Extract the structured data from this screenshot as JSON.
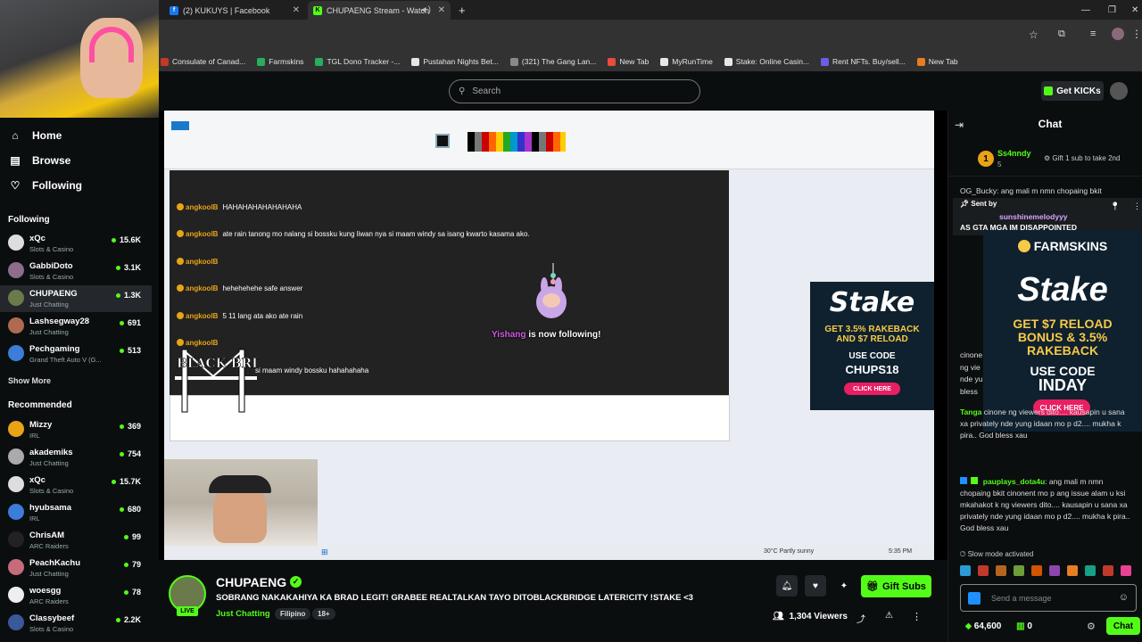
{
  "browser": {
    "tabs": [
      {
        "title": "(2) KUKUYS | Facebook",
        "active": false
      },
      {
        "title": "CHUPAENG Stream - Watch",
        "active": true
      }
    ],
    "new_tab_label": "+",
    "bookmarks": [
      {
        "label": "Consulate of Canad...",
        "color": "#c0392b"
      },
      {
        "label": "Farmskins",
        "color": "#27ae60"
      },
      {
        "label": "TGL Dono Tracker -...",
        "color": "#27ae60"
      },
      {
        "label": "Pustahan Nights Bet...",
        "color": "#e6e6e6"
      },
      {
        "label": "(321) The Gang Lan...",
        "color": "#888"
      },
      {
        "label": "New Tab",
        "color": "#e74c3c"
      },
      {
        "label": "MyRunTime",
        "color": "#e6e6e6"
      },
      {
        "label": "Stake: Online Casin...",
        "color": "#e6e6e6"
      },
      {
        "label": "Rent NFTs. Buy/sell...",
        "color": "#6c5ce7"
      },
      {
        "label": "New Tab",
        "color": "#e67e22"
      }
    ]
  },
  "topnav": {
    "search_placeholder": "Search",
    "get_kicks": "Get KICKs"
  },
  "sidebar": {
    "nav": [
      {
        "label": "Home",
        "icon": "home-icon"
      },
      {
        "label": "Browse",
        "icon": "browse-icon"
      },
      {
        "label": "Following",
        "icon": "heart-icon"
      }
    ],
    "following_title": "Following",
    "following": [
      {
        "name": "xQc",
        "category": "Slots & Casino",
        "viewers": "15.6K",
        "color": "#ddd"
      },
      {
        "name": "GabbiDoto",
        "category": "Slots & Casino",
        "viewers": "3.1K",
        "color": "#8e6c8a"
      },
      {
        "name": "CHUPAENG",
        "category": "Just Chatting",
        "viewers": "1.3K",
        "color": "#6a7a4a"
      },
      {
        "name": "Lashsegway28",
        "category": "Just Chatting",
        "viewers": "691",
        "color": "#b06a50"
      },
      {
        "name": "Pechgaming",
        "category": "Grand Theft Auto V (G...",
        "viewers": "513",
        "color": "#3b7dd8"
      }
    ],
    "show_more": "Show More",
    "recommended_title": "Recommended",
    "recommended": [
      {
        "name": "Mizzy",
        "category": "IRL",
        "viewers": "369",
        "color": "#e8a317"
      },
      {
        "name": "akademiks",
        "category": "Just Chatting",
        "viewers": "754",
        "color": "#aaa"
      },
      {
        "name": "xQc",
        "category": "Slots & Casino",
        "viewers": "15.7K",
        "color": "#ddd"
      },
      {
        "name": "hyubsama",
        "category": "IRL",
        "viewers": "680",
        "color": "#3b7dd8"
      },
      {
        "name": "ChrisAM",
        "category": "ARC Raiders",
        "viewers": "99",
        "color": "#222"
      },
      {
        "name": "PeachKachu",
        "category": "Just Chatting",
        "viewers": "79",
        "color": "#c56b7a"
      },
      {
        "name": "woesgg",
        "category": "ARC Raiders",
        "viewers": "78",
        "color": "#eee"
      },
      {
        "name": "Classybeef",
        "category": "Slots & Casino",
        "viewers": "2.2K",
        "color": "#3b5998"
      }
    ]
  },
  "stream_overlay": {
    "chat_lines": [
      {
        "user": "angkoolB",
        "text": "HAHAHAHAHAHAHAHA"
      },
      {
        "user": "angkoolB",
        "text": "ate rain tanong mo nalang si bossku kung liwan nya si maam windy sa isang kwarto kasama ako."
      },
      {
        "user": "angkoolB",
        "text": ""
      },
      {
        "user": "angkoolB",
        "text": "hehehehehe safe answer"
      },
      {
        "user": "angkoolB",
        "text": "5 11 lang ata ako ate rain"
      },
      {
        "user": "angkoolB",
        "text": ""
      },
      {
        "user": "",
        "text": "si maam windy bossku hahahahaha"
      }
    ],
    "follow_name": "Yishang",
    "follow_text": "is now following!",
    "watermark": "BLACK BRIDGE",
    "stake_ad": {
      "logo": "Stake",
      "headline": "GET 3.5% RAKEBACK AND $7 RELOAD",
      "use_code": "USE CODE",
      "code": "CHUPS18",
      "cta": "CLICK HERE"
    },
    "taskbar_weather": "30°C Partly sunny",
    "taskbar_time": "5:35 PM"
  },
  "stream_info": {
    "streamer": "CHUPAENG",
    "live_label": "LIVE",
    "title": "SOBRANG NAKAKAHIYA KA BRAD LEGIT! GRABEE REALTALKAN TAYO DITOBLACKBRIDGE LATER!CITY !STAKE <3",
    "category": "Just Chatting",
    "tags": [
      "Filipino",
      "18+"
    ],
    "gift_subs": "Gift Subs",
    "viewers": "1,304 Viewers"
  },
  "chat": {
    "title": "Chat",
    "gifter": {
      "name": "Ss4nndy",
      "count": "5",
      "gift_text": "Gift 1 sub to take 2nd",
      "rank": "1"
    },
    "top_cut": "OG_Bucky: ang mali m nmn chopaing bkit",
    "pinned": {
      "label": "Sent by",
      "user": "sunshinemelodyyy",
      "text": "AS GTA MGA IM DISAPPOINTED"
    },
    "stake_ad": {
      "brand": "FARMSKINS",
      "logo": "Stake",
      "headline": "GET $7 RELOAD BONUS & 3.5% RAKEBACK",
      "use_code": "USE CODE",
      "code": "INDAY",
      "cta": "CLICK HERE"
    },
    "left_frag": [
      "cinone",
      "ng vie",
      "nde yu",
      "bless"
    ],
    "messages": [
      {
        "user": "Tanga",
        "color": "#53fc18",
        "text": "cinone ng viewers dito.... kausapin u sana xa privately nde yung idaan mo p d2.... mukha k pira.. God bless xau"
      },
      {
        "user": "pauplays_dota4u",
        "color": "#53fc18",
        "text": "ang mali m nmn chopaing bkit cinonent mo p ang issue alam u ksi mkahakot k ng viewers dito.... kausapin u sana xa privately nde yung idaan mo p d2.... mukha k pira.. God bless xau"
      }
    ],
    "slow_mode": "Slow mode activated",
    "input_placeholder": "Send a message",
    "kicks": "64,600",
    "zero": "0",
    "send": "Chat"
  }
}
